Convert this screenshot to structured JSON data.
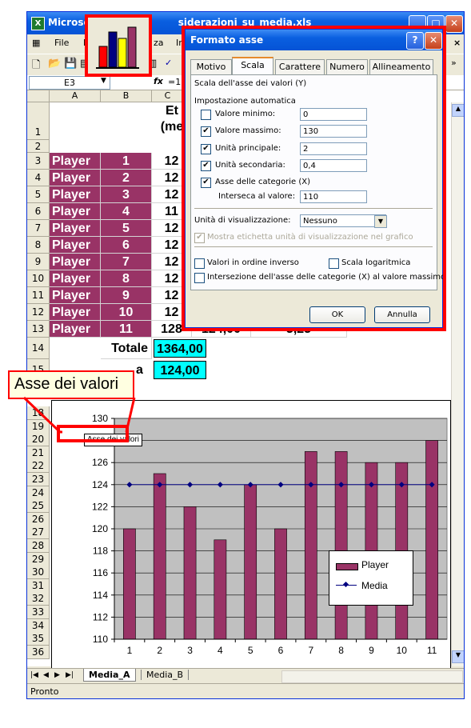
{
  "window": {
    "title": "Microsoft Excel - considerazioni_su_media.xls",
    "title_left": "Microso",
    "title_right": "siderazioni_su_media.xls"
  },
  "menu": [
    "File",
    "M",
    "za",
    "In"
  ],
  "formula": {
    "cell_ref": "E3",
    "fx": "fx",
    "value": "=1"
  },
  "columns": [
    "A",
    "B",
    "C"
  ],
  "header_c": [
    "Et",
    "(me"
  ],
  "rows": [
    {
      "n": "1"
    },
    {
      "n": "2"
    },
    {
      "n": "3",
      "label": "Player",
      "num": "1",
      "c": "12"
    },
    {
      "n": "4",
      "label": "Player",
      "num": "2",
      "c": "12"
    },
    {
      "n": "5",
      "label": "Player",
      "num": "3",
      "c": "12"
    },
    {
      "n": "6",
      "label": "Player",
      "num": "4",
      "c": "11"
    },
    {
      "n": "7",
      "label": "Player",
      "num": "5",
      "c": "12"
    },
    {
      "n": "8",
      "label": "Player",
      "num": "6",
      "c": "12"
    },
    {
      "n": "9",
      "label": "Player",
      "num": "7",
      "c": "12"
    },
    {
      "n": "10",
      "label": "Player",
      "num": "8",
      "c": "12"
    },
    {
      "n": "11",
      "label": "Player",
      "num": "9",
      "c": "12"
    },
    {
      "n": "12",
      "label": "Player",
      "num": "10",
      "c": "12"
    },
    {
      "n": "13",
      "label": "Player",
      "num": "11",
      "c": "128",
      "d": "124,00",
      "e": "3,23"
    },
    {
      "n": "14",
      "total_label": "Totale",
      "total_value": "1364,00"
    },
    {
      "n": "15",
      "media_frag": "a",
      "media_value": "124,00"
    }
  ],
  "chart_row_numbers": [
    "18",
    "19",
    "20",
    "21",
    "22",
    "23",
    "24",
    "25",
    "26",
    "27",
    "28",
    "29",
    "30",
    "31",
    "32",
    "33",
    "34",
    "35",
    "36"
  ],
  "callout": {
    "big": "Asse dei valori",
    "small": "Asse dei valori"
  },
  "dialog": {
    "title": "Formato asse",
    "tabs": [
      "Motivo",
      "Scala",
      "Carattere",
      "Numero",
      "Allineamento"
    ],
    "section": "Scala dell'asse dei valori (Y)",
    "auto": "Impostazione automatica",
    "fields": [
      {
        "label": "Valore minimo:",
        "checked": false,
        "value": "0"
      },
      {
        "label": "Valore massimo:",
        "checked": true,
        "value": "130"
      },
      {
        "label": "Unità principale:",
        "checked": true,
        "value": "2"
      },
      {
        "label": "Unità secondaria:",
        "checked": true,
        "value": "0,4"
      }
    ],
    "cross_label": "Asse delle categorie (X)",
    "cross_at_label": "Interseca al valore:",
    "cross_at_value": "110",
    "display_units_label": "Unità di visualizzazione:",
    "display_units_value": "Nessuno",
    "show_units_label": "Mostra etichetta unità di visualizzazione nel grafico",
    "reverse": "Valori in ordine inverso",
    "log": "Scala logaritmica",
    "cross_max": "Intersezione dell'asse delle categorie (X) al valore massimo",
    "ok": "OK",
    "cancel": "Annulla",
    "help": "?",
    "close": "✕"
  },
  "sheet_tabs": [
    "Media_A",
    "Media_B"
  ],
  "status": "Pronto",
  "colors": {
    "bar": "#993366",
    "plot_bg": "#c0c0c0",
    "media_line": "#000080",
    "cyan": "#00ffff",
    "highlight": "#ff0000"
  },
  "chart_data": {
    "type": "bar",
    "categories": [
      "1",
      "2",
      "3",
      "4",
      "5",
      "6",
      "7",
      "8",
      "9",
      "10",
      "11"
    ],
    "series": [
      {
        "name": "Player",
        "type": "bar",
        "values": [
          120,
          125,
          122,
          119,
          124,
          120,
          127,
          127,
          126,
          126,
          128
        ]
      },
      {
        "name": "Media",
        "type": "line",
        "values": [
          124,
          124,
          124,
          124,
          124,
          124,
          124,
          124,
          124,
          124,
          124
        ]
      }
    ],
    "ylim": [
      110,
      130
    ],
    "yticks": [
      "130",
      "128",
      "126",
      "124",
      "122",
      "120",
      "118",
      "116",
      "114",
      "112",
      "110"
    ],
    "grid": true,
    "legend": "right"
  }
}
